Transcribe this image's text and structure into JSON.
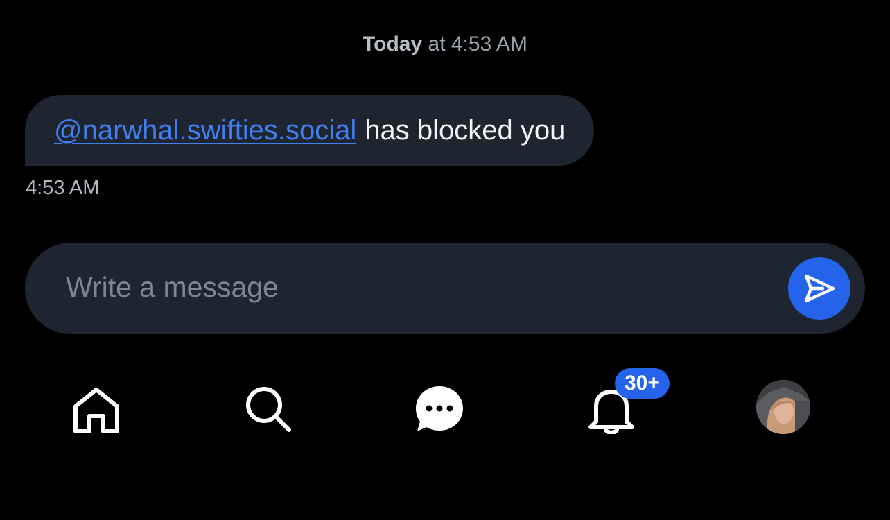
{
  "header": {
    "date_day": "Today",
    "date_rest": " at 4:53 AM"
  },
  "message": {
    "mention": "@narwhal.swifties.social",
    "text": "has blocked you",
    "time": "4:53 AM"
  },
  "composer": {
    "placeholder": "Write a message"
  },
  "nav": {
    "items": [
      {
        "icon": "home-icon"
      },
      {
        "icon": "search-icon"
      },
      {
        "icon": "chat-icon"
      },
      {
        "icon": "bell-icon"
      },
      {
        "icon": "avatar"
      }
    ],
    "notifications_badge": "30+"
  },
  "colors": {
    "background": "#000000",
    "bubble": "#1e2530",
    "accent": "#2563eb",
    "link": "#3f7ff0"
  }
}
